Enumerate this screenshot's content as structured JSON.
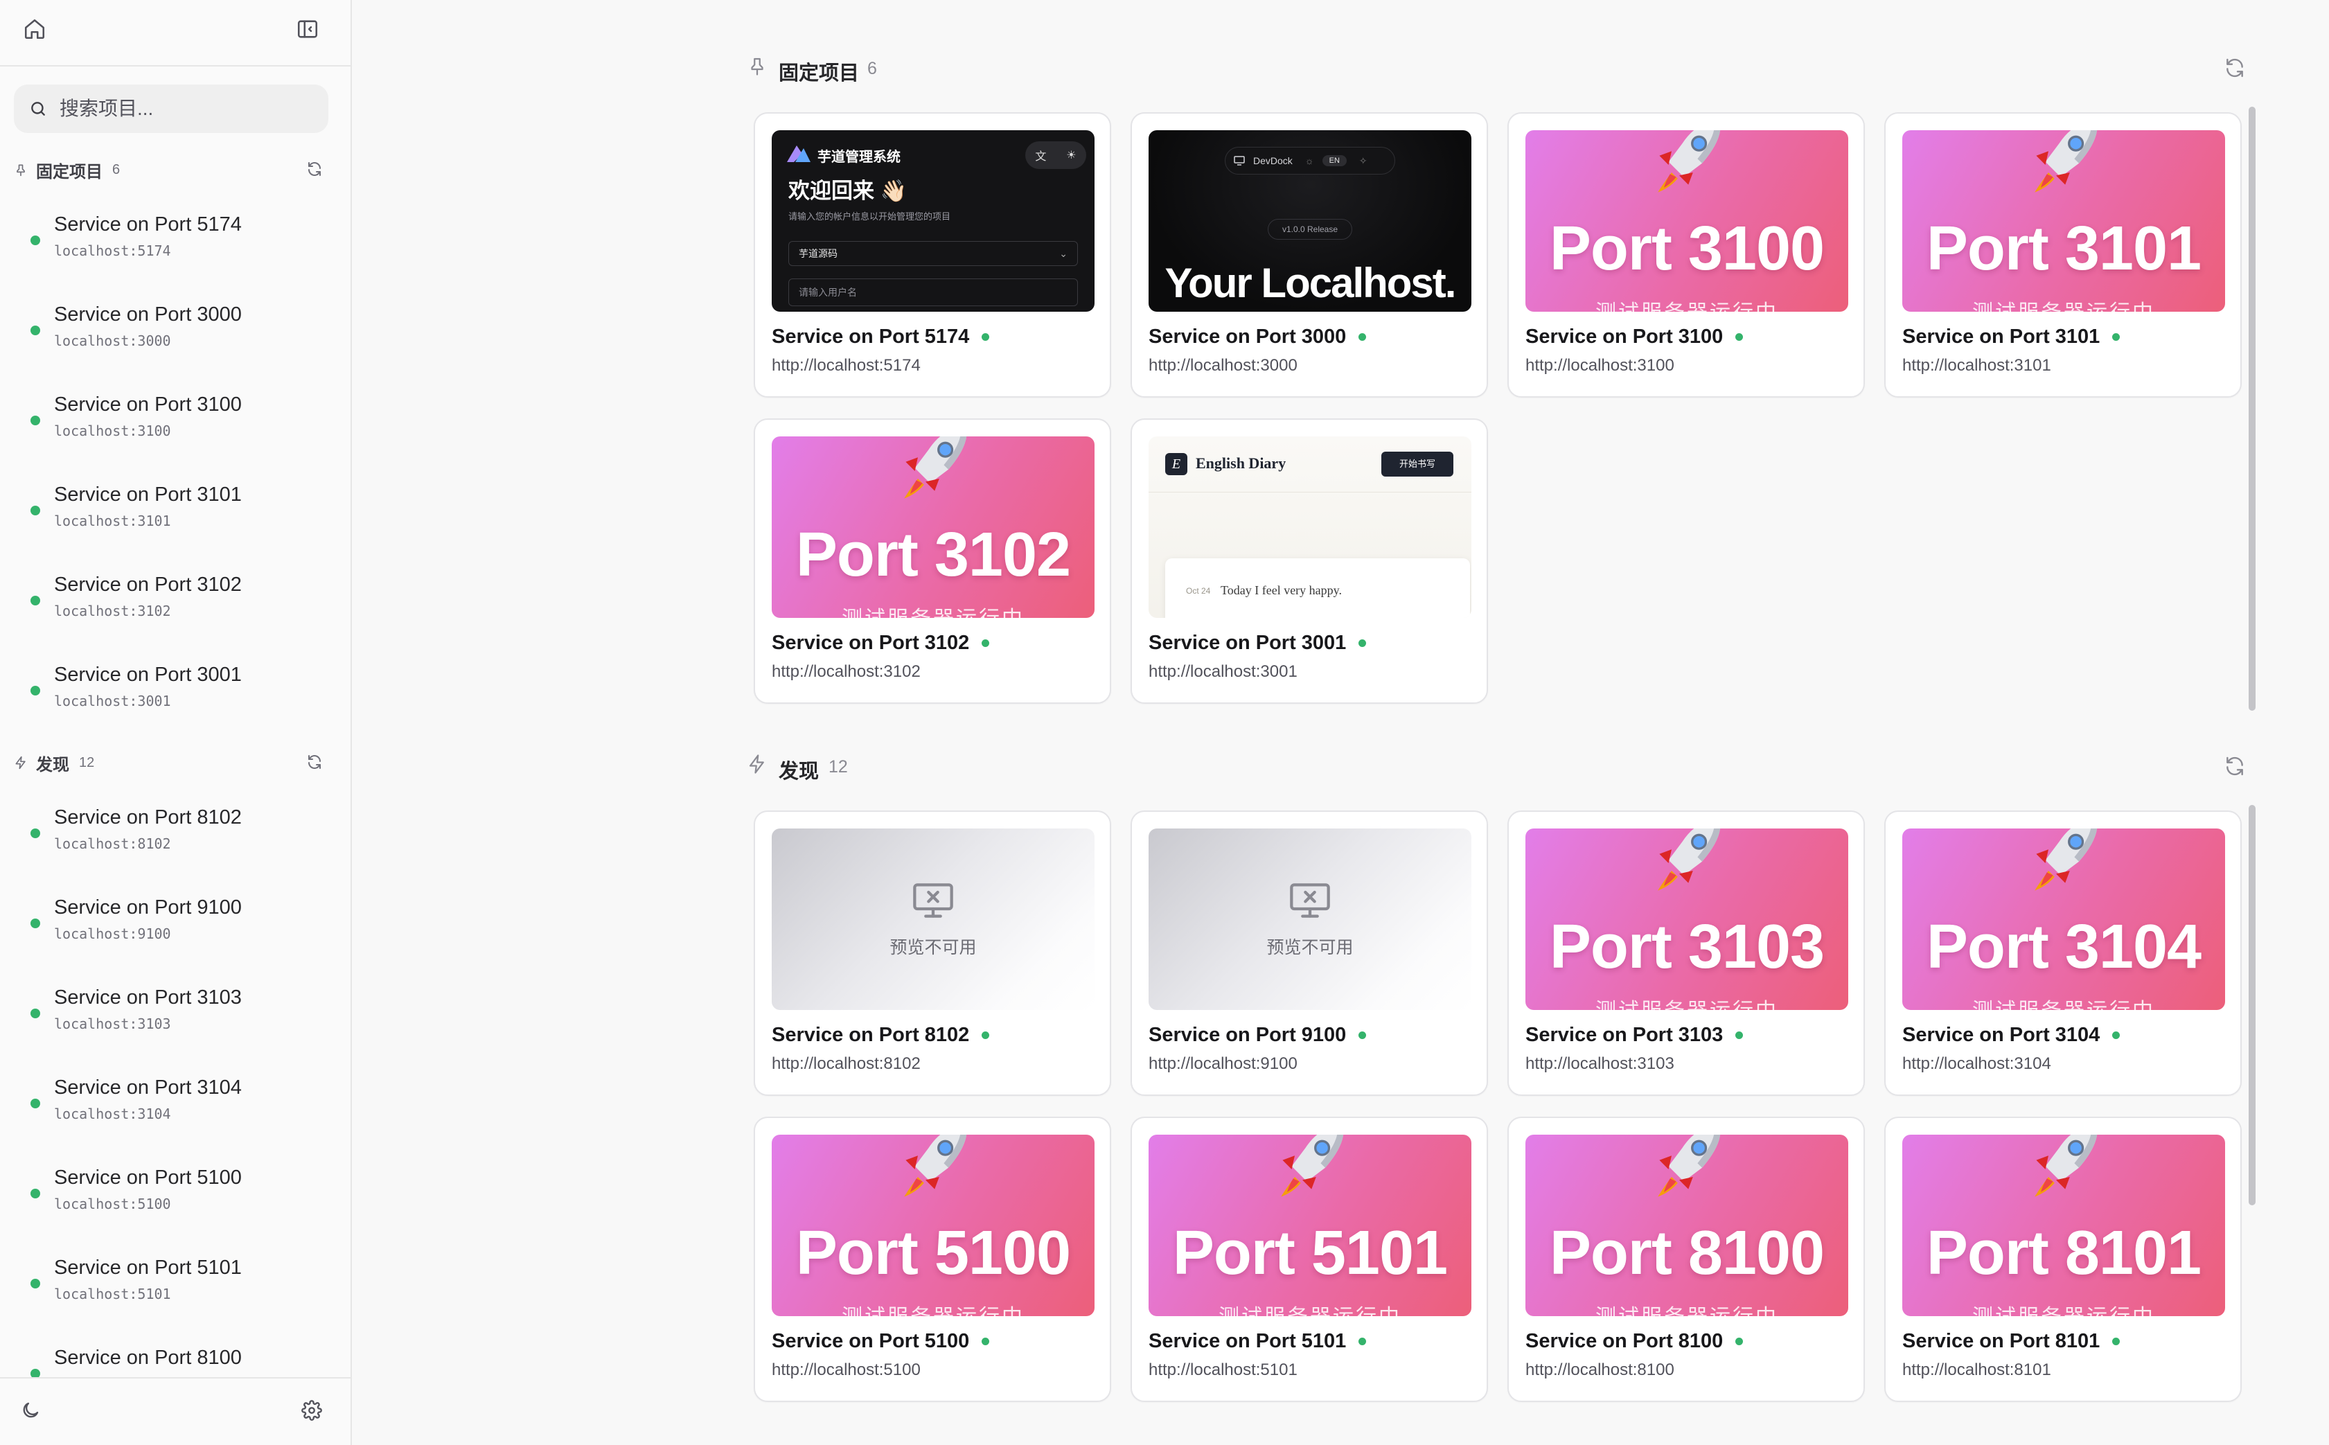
{
  "colors": {
    "online": "#34b36b",
    "pink_start": "#e27ee9",
    "pink_end": "#ec5f7a"
  },
  "sidebar": {
    "search_placeholder": "搜索项目...",
    "pinned": {
      "title": "固定项目",
      "count": "6",
      "items": [
        {
          "name": "Service on Port 5174",
          "host": "localhost:5174"
        },
        {
          "name": "Service on Port 3000",
          "host": "localhost:3000"
        },
        {
          "name": "Service on Port 3100",
          "host": "localhost:3100"
        },
        {
          "name": "Service on Port 3101",
          "host": "localhost:3101"
        },
        {
          "name": "Service on Port 3102",
          "host": "localhost:3102"
        },
        {
          "name": "Service on Port 3001",
          "host": "localhost:3001"
        }
      ]
    },
    "discover": {
      "title": "发现",
      "count": "12",
      "items": [
        {
          "name": "Service on Port 8102",
          "host": "localhost:8102"
        },
        {
          "name": "Service on Port 9100",
          "host": "localhost:9100"
        },
        {
          "name": "Service on Port 3103",
          "host": "localhost:3103"
        },
        {
          "name": "Service on Port 3104",
          "host": "localhost:3104"
        },
        {
          "name": "Service on Port 5100",
          "host": "localhost:5100"
        },
        {
          "name": "Service on Port 5101",
          "host": "localhost:5101"
        },
        {
          "name": "Service on Port 8100"
        }
      ]
    }
  },
  "main": {
    "pinned": {
      "title": "固定项目",
      "count": "6",
      "cards": [
        {
          "title": "Service on Port 5174",
          "url": "http://localhost:5174",
          "preview": {
            "brand": "芋道管理系统",
            "welcome": "欢迎回来 👋🏻",
            "hint": "请输入您的帐户信息以开始管理您的项目",
            "select": "芋道源码",
            "input": "请输入用户名"
          }
        },
        {
          "title": "Service on Port 3000",
          "url": "http://localhost:3000",
          "preview": {
            "nav_name": "DevDock",
            "lang": "EN",
            "pill": "v1.0.0 Release",
            "headline": "Your Localhost."
          }
        },
        {
          "title": "Service on Port 3100",
          "url": "http://localhost:3100",
          "preview": {
            "port_text": "Port 3100",
            "sub": "测试服务器运行中"
          }
        },
        {
          "title": "Service on Port 3101",
          "url": "http://localhost:3101",
          "preview": {
            "port_text": "Port 3101",
            "sub": "测试服务器运行中"
          }
        },
        {
          "title": "Service on Port 3102",
          "url": "http://localhost:3102",
          "preview": {
            "port_text": "Port 3102",
            "sub": "测试服务器运行中"
          }
        },
        {
          "title": "Service on Port 3001",
          "url": "http://localhost:3001",
          "preview": {
            "logo": "E",
            "name": "English Diary",
            "button": "开始书写",
            "date": "Oct 24",
            "entry": "Today I feel very happy."
          }
        }
      ]
    },
    "discover": {
      "title": "发现",
      "count": "12",
      "cards": [
        {
          "title": "Service on Port 8102",
          "url": "http://localhost:8102",
          "preview": {
            "unavailable": "预览不可用"
          }
        },
        {
          "title": "Service on Port 9100",
          "url": "http://localhost:9100",
          "preview": {
            "unavailable": "预览不可用"
          }
        },
        {
          "title": "Service on Port 3103",
          "url": "http://localhost:3103",
          "preview": {
            "port_text": "Port 3103",
            "sub": "测试服务器运行中"
          }
        },
        {
          "title": "Service on Port 3104",
          "url": "http://localhost:3104",
          "preview": {
            "port_text": "Port 3104",
            "sub": "测试服务器运行中"
          }
        },
        {
          "title": "Service on Port 5100",
          "url": "http://localhost:5100",
          "preview": {
            "port_text": "Port 5100",
            "sub": "测试服务器运行中"
          }
        },
        {
          "title": "Service on Port 5101",
          "url": "http://localhost:5101",
          "preview": {
            "port_text": "Port 5101",
            "sub": "测试服务器运行中"
          }
        },
        {
          "title": "Service on Port 8100",
          "url": "http://localhost:8100",
          "preview": {
            "port_text": "Port 8100",
            "sub": "测试服务器运行中"
          }
        },
        {
          "title": "Service on Port 8101",
          "url": "http://localhost:8101",
          "preview": {
            "port_text": "Port 8101",
            "sub": "测试服务器运行中"
          }
        }
      ]
    }
  }
}
